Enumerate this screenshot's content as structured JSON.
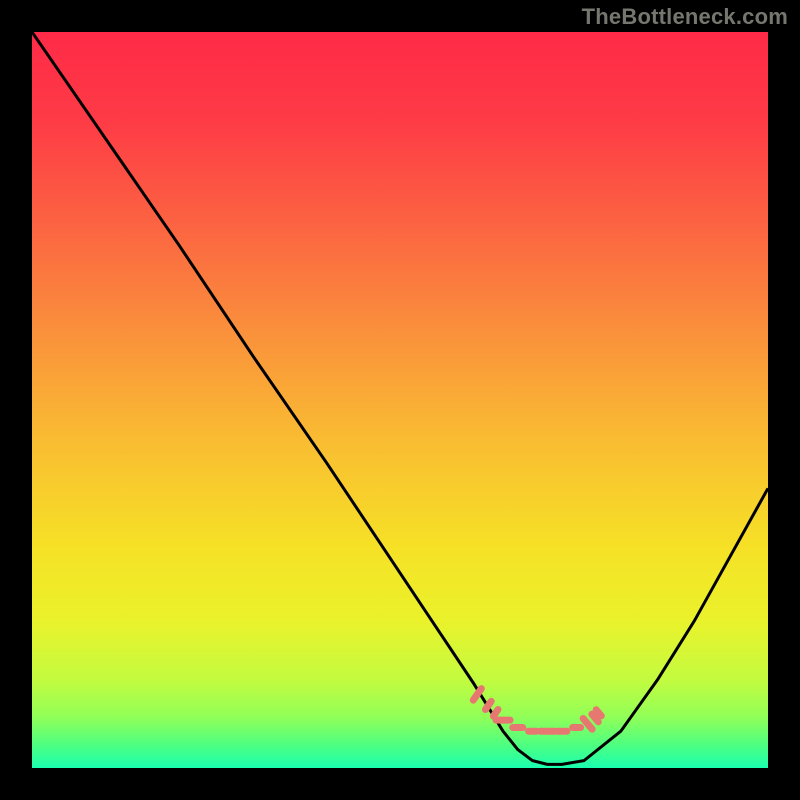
{
  "watermark": "TheBottleneck.com",
  "chart_data": {
    "type": "line",
    "title": "",
    "xlabel": "",
    "ylabel": "",
    "xlim": [
      0,
      100
    ],
    "ylim": [
      0,
      100
    ],
    "series": [
      {
        "name": "curve",
        "x": [
          0,
          10,
          20,
          30,
          40,
          50,
          55,
          60,
          64,
          66,
          68,
          70,
          72,
          75,
          80,
          85,
          90,
          95,
          100
        ],
        "y": [
          100,
          85.5,
          71,
          56,
          41.5,
          26.5,
          19,
          11.5,
          5,
          2.5,
          1,
          0.5,
          0.5,
          1,
          5,
          12,
          20,
          29,
          38
        ]
      },
      {
        "name": "salmon-dashes",
        "x": [
          60.5,
          62,
          63,
          64,
          66,
          68,
          70,
          72,
          74,
          75.5,
          76.5,
          77
        ],
        "y": [
          10,
          8.5,
          7.5,
          6.5,
          5.5,
          5,
          5,
          5,
          5.5,
          6,
          6.8,
          7.5
        ]
      }
    ],
    "background_gradient_stops": [
      {
        "offset": 0.0,
        "color": "#ff2a47"
      },
      {
        "offset": 0.12,
        "color": "#fe3b46"
      },
      {
        "offset": 0.25,
        "color": "#fc6042"
      },
      {
        "offset": 0.4,
        "color": "#fa8e3c"
      },
      {
        "offset": 0.55,
        "color": "#f9bb32"
      },
      {
        "offset": 0.7,
        "color": "#f6e126"
      },
      {
        "offset": 0.8,
        "color": "#eaf22b"
      },
      {
        "offset": 0.88,
        "color": "#c3fb3f"
      },
      {
        "offset": 0.93,
        "color": "#92ff57"
      },
      {
        "offset": 0.97,
        "color": "#4bff82"
      },
      {
        "offset": 1.0,
        "color": "#1affb0"
      }
    ],
    "colors": {
      "curve": "#000000",
      "dashes": "#e77871",
      "frame": "#000000"
    }
  }
}
